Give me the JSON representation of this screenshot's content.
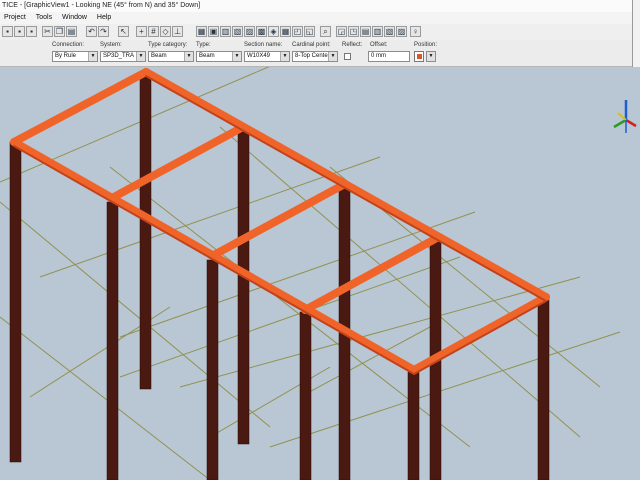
{
  "window": {
    "title": "TICE - [GraphicView1 - Looking NE (45° from N) and 35° Down]"
  },
  "menu": [
    {
      "label": "Project"
    },
    {
      "label": "Tools"
    },
    {
      "label": "Window"
    },
    {
      "label": "Help"
    }
  ],
  "toolbar": {
    "icons": [
      "open-icon",
      "save-icon",
      "print-icon",
      "cut-icon",
      "copy-icon",
      "paste-icon",
      "undo-icon",
      "redo-icon",
      "select-icon",
      "place-icon",
      "grid-icon",
      "snap-icon",
      "measure-icon",
      "properties-icon",
      "refresh-icon",
      "settings-icon",
      "help-icon",
      "zoom-icon",
      "pan-icon",
      "rotate-icon",
      "fit-icon",
      "view-icon",
      "layers-icon",
      "filter-icon",
      "lock-icon"
    ]
  },
  "ribbon": {
    "connection_label": "Connection:",
    "connection_value": "By Rule",
    "system_label": "System:",
    "system_value": "SP3D_TRA",
    "type_category_label": "Type category:",
    "type_category_value": "Beam",
    "type_label": "Type:",
    "type_value": "Beam",
    "section_name_label": "Section name:",
    "section_name_value": "W10X49",
    "cardinal_point_label": "Cardinal point:",
    "cardinal_point_value": "8-Top Cente",
    "reflect_label": "Reflect:",
    "offset_label": "Offset:",
    "offset_value": "0 mm",
    "position_label": "Position:"
  },
  "colors": {
    "background": "#b9c6d3",
    "beam": "#f0642a",
    "column": "#4a1a12",
    "grid": "#8a8a3c"
  }
}
